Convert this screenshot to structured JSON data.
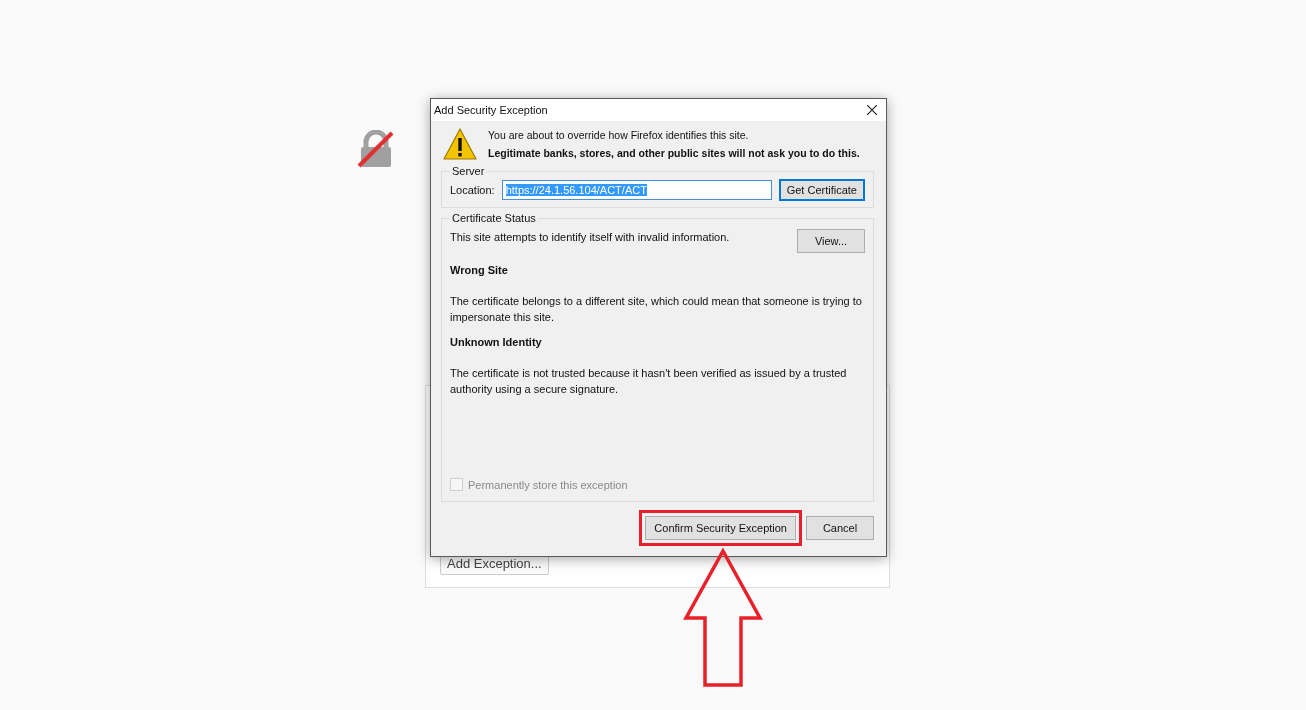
{
  "window": {
    "title": "Add Security Exception"
  },
  "warning": {
    "line1": "You are about to override how Firefox identifies this site.",
    "line2": "Legitimate banks, stores, and other public sites will not ask you to do this."
  },
  "server": {
    "legend": "Server",
    "location_label": "Location:",
    "location_value": "https://24.1.56.104/ACT/ACT",
    "value_selected": true,
    "get_certificate_button": "Get Certificate"
  },
  "certificate_status": {
    "legend": "Certificate Status",
    "summary": "This site attempts to identify itself with invalid information.",
    "view_button": "View...",
    "issues": [
      {
        "title": "Wrong Site",
        "description": "The certificate belongs to a different site, which could mean that someone is trying to impersonate this site."
      },
      {
        "title": "Unknown Identity",
        "description": "The certificate is not trusted because it hasn't been verified as issued by a trusted authority using a secure signature."
      }
    ]
  },
  "permanent_store": {
    "label": "Permanently store this exception",
    "checked": false,
    "disabled": true
  },
  "buttons": [
    {
      "label": "Confirm Security Exception",
      "highlighted": true
    },
    {
      "label": "Cancel",
      "highlighted": false
    }
  ],
  "background_page": {
    "add_exception_button": "Add Exception..."
  }
}
